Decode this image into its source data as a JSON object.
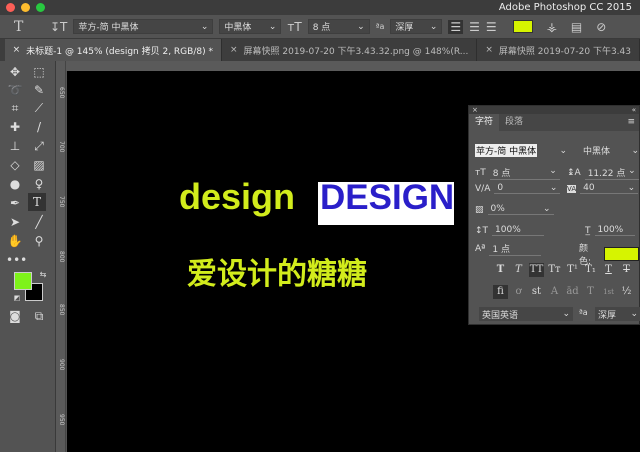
{
  "app": {
    "title": "Adobe Photoshop CC 2015"
  },
  "options": {
    "tool_icon": "T",
    "font_family": "苹方-简 中黑体",
    "font_style": "中黑体",
    "font_size": "8 点",
    "antialias": "深厚",
    "text_color": "#d6f400"
  },
  "tabs": [
    {
      "label": "未标题-1 @ 145% (design 拷贝 2, RGB/8) *",
      "active": true
    },
    {
      "label": "屏幕快照 2019-07-20 下午3.43.32.png @ 148%(R...",
      "active": false
    },
    {
      "label": "屏幕快照 2019-07-20 下午3.43",
      "active": false
    }
  ],
  "ruler": {
    "labels": [
      "650",
      "700",
      "750",
      "800",
      "850",
      "900",
      "950"
    ]
  },
  "canvas": {
    "text1": "design",
    "text2": "DESIGN",
    "text3": "爱设计的糖糖",
    "text1_color": "#d2ec1c",
    "text2_color": "#2a1fc9"
  },
  "panel": {
    "tabs": [
      "字符",
      "段落"
    ],
    "font_family": "苹方-简 中黑体",
    "font_style": "中黑体",
    "size": "8 点",
    "leading": "11.22 点",
    "kerning": "0",
    "tracking": "40",
    "tsume": "0%",
    "vscale": "100%",
    "hscale": "100%",
    "baseline": "1 点",
    "color_label": "颜色:",
    "color": "#d6f400",
    "style_buttons": [
      "T",
      "T",
      "TT",
      "Tт",
      "T¹",
      "T₁",
      "T",
      "T"
    ],
    "opentype_buttons": [
      "fi",
      "ơ",
      "st",
      "A",
      "ād",
      "T",
      "1st",
      "½"
    ],
    "language": "英国英语",
    "aa_icon": "ªa",
    "antialias": "深厚"
  },
  "colors": {
    "foreground": "#7ef21a",
    "background": "#000000"
  }
}
